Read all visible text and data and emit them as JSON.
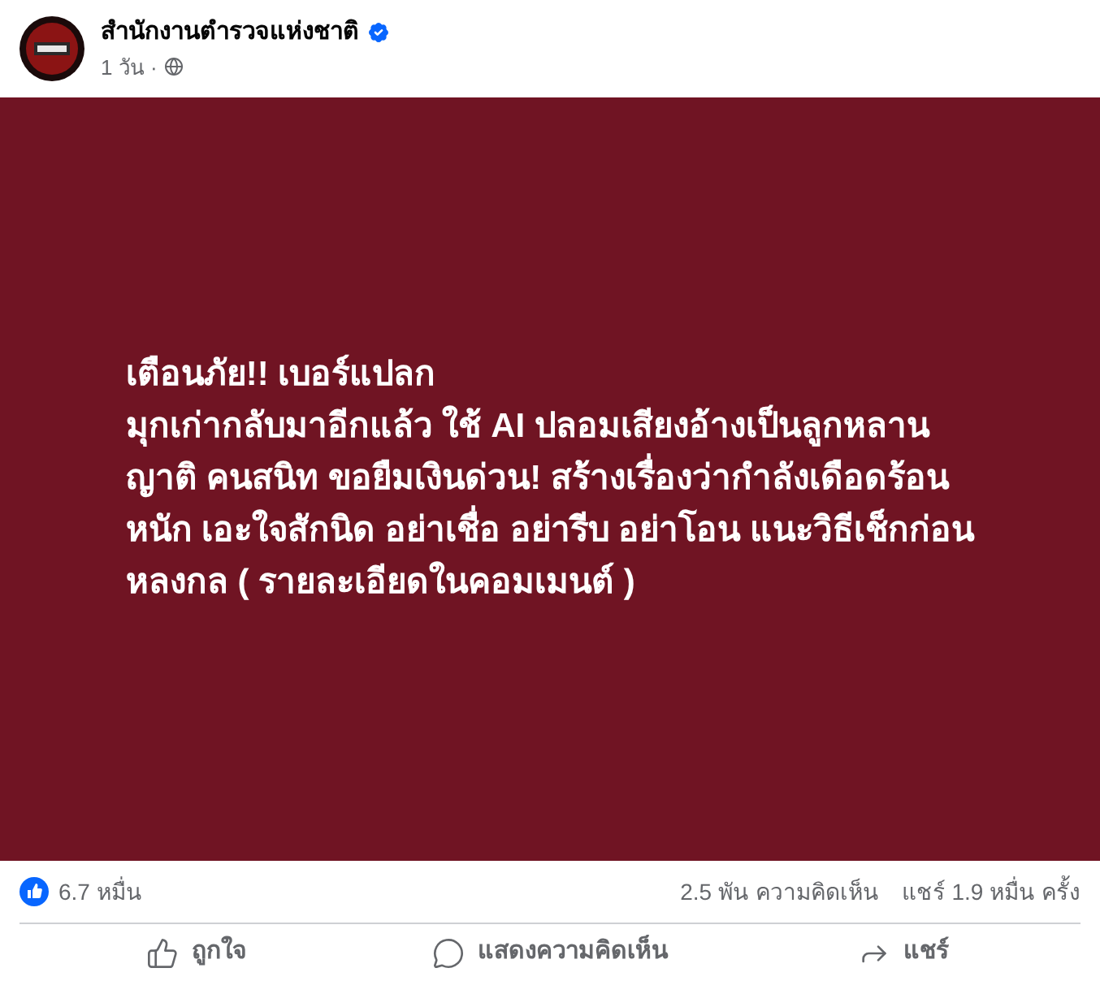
{
  "post": {
    "author": "สำนักงานตำรวจแห่งชาติ",
    "verified": true,
    "time": "1 วัน ·"
  },
  "banner": {
    "lines": [
      "เตือนภัย!! เบอร์แปลก",
      "มุกเก่ากลับมาอีกแล้ว ใช้ AI ปลอมเสียงอ้างเป็นลูกหลาน",
      "ญาติ คนสนิท ขอยืมเงินด่วน! สร้างเรื่องว่ากำลังเดือดร้อน",
      "หนัก เอะใจสักนิด อย่าเชื่อ อย่ารีบ อย่าโอน แนะวิธีเช็กก่อน",
      "หลงกล ( รายละเอียดในคอมเมนต์ )"
    ]
  },
  "stats": {
    "reactions": "6.7 หมื่น",
    "comments": "2.5 พัน ความคิดเห็น",
    "shares": "แชร์ 1.9 หมื่น ครั้ง"
  },
  "actions": [
    {
      "kind": "like",
      "label": "ถูกใจ"
    },
    {
      "kind": "comment",
      "label": "แสดงความคิดเห็น"
    },
    {
      "kind": "share",
      "label": "แชร์"
    }
  ]
}
